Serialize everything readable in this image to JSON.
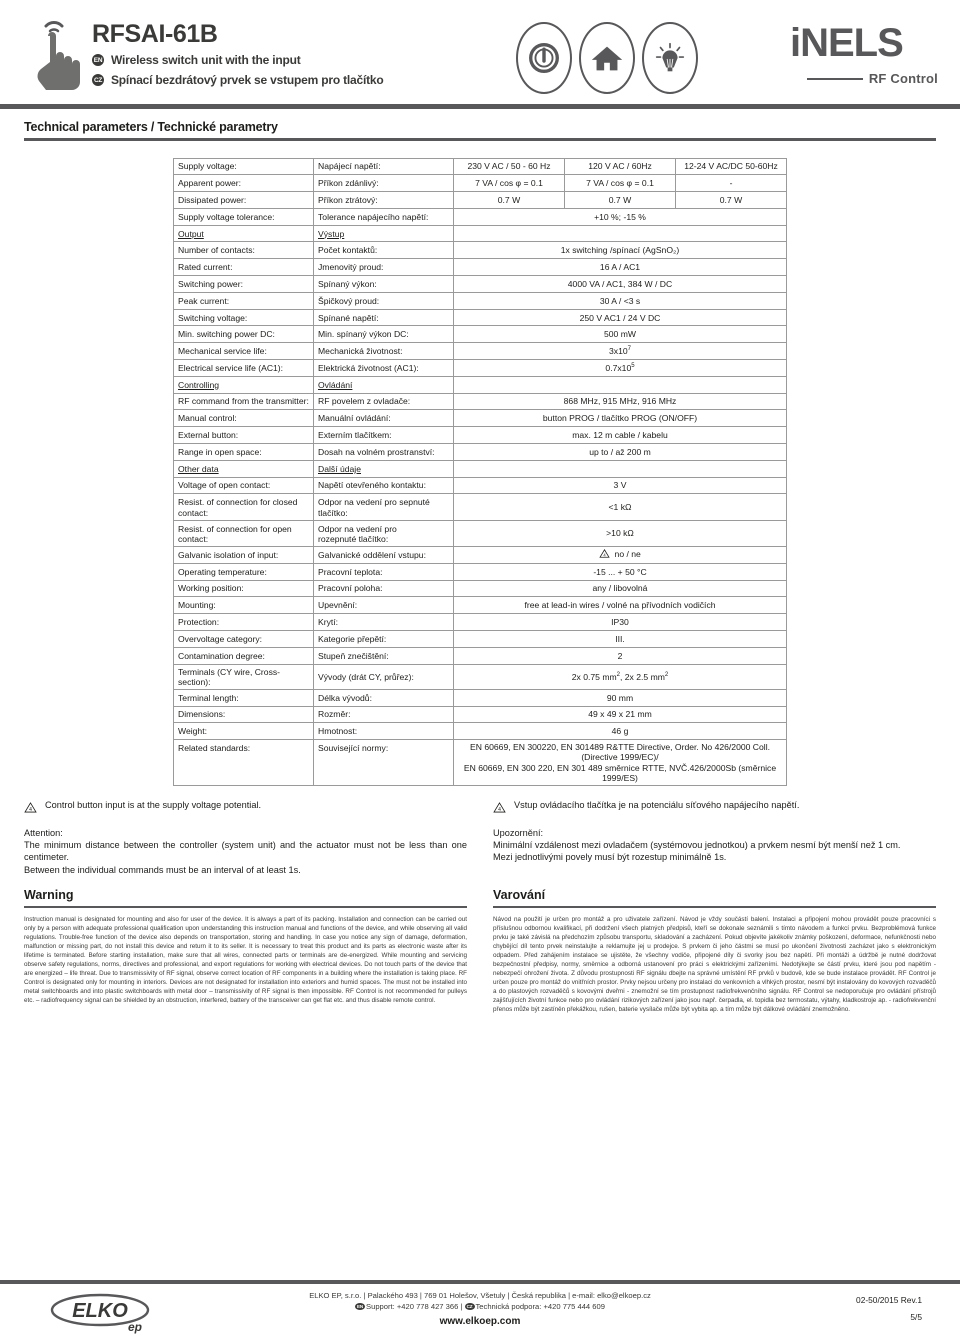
{
  "header": {
    "product_code": "RFSAI-61B",
    "en_badge": "EN",
    "cz_badge": "CZ",
    "en_subtitle": "Wireless switch unit with the input",
    "cz_subtitle": "Spínací bezdrátový prvek se vstupem pro tlačítko",
    "icons": [
      "power-icon",
      "home-icon",
      "bulb-icon"
    ],
    "brand": "iNELS",
    "brand_tagline": "RF Control"
  },
  "tech_section": {
    "title": "Technical parameters / Technické parametry"
  },
  "table": {
    "rows": [
      {
        "type": "multi",
        "en": "Supply voltage:",
        "cz": "Napájecí napětí:",
        "v1": "230 V AC / 50 - 60 Hz",
        "v2": "120 V AC / 60Hz",
        "v3": "12-24 V AC/DC 50-60Hz"
      },
      {
        "type": "multi",
        "en": "Apparent power:",
        "cz": "Příkon zdánlivý:",
        "v1": "7 VA / cos φ = 0.1",
        "v2": "7 VA / cos φ = 0.1",
        "v3": "-"
      },
      {
        "type": "multi",
        "en": "Dissipated power:",
        "cz": "Příkon ztrátový:",
        "v1": "0.7 W",
        "v2": "0.7 W",
        "v3": "0.7 W"
      },
      {
        "type": "single",
        "en": "Supply voltage tolerance:",
        "cz": "Tolerance napájecího napětí:",
        "v": "+10 %; -15 %"
      },
      {
        "type": "group",
        "en": "Output",
        "cz": "Výstup"
      },
      {
        "type": "single",
        "en": "Number of contacts:",
        "cz": "Počet kontaktů:",
        "v": "1x switching /spínací (AgSnO₂)"
      },
      {
        "type": "single",
        "en": "Rated current:",
        "cz": "Jmenovitý proud:",
        "v": "16 A / AC1"
      },
      {
        "type": "single",
        "en": "Switching power:",
        "cz": "Spínaný výkon:",
        "v": "4000 VA / AC1, 384 W / DC"
      },
      {
        "type": "single",
        "en": "Peak current:",
        "cz": "Špičkový proud:",
        "v": "30 A / <3 s"
      },
      {
        "type": "single",
        "en": "Switching voltage:",
        "cz": "Spínané napětí:",
        "v": "250 V AC1 / 24 V DC"
      },
      {
        "type": "single",
        "en": "Min. switching power DC:",
        "cz": "Min. spínaný výkon DC:",
        "v": "500 mW"
      },
      {
        "type": "sup",
        "en": "Mechanical service life:",
        "cz": "Mechanická životnost:",
        "base": "3x10",
        "exp": "7"
      },
      {
        "type": "sup",
        "en": "Electrical service life (AC1):",
        "cz": "Elektrická životnost (AC1):",
        "base": "0.7x10",
        "exp": "5"
      },
      {
        "type": "group",
        "en": "Controlling",
        "cz": "Ovládání"
      },
      {
        "type": "single",
        "en": "RF command from the transmitter:",
        "cz": "RF povelem z ovladače:",
        "v": "868 MHz, 915 MHz, 916 MHz"
      },
      {
        "type": "single",
        "en": "Manual control:",
        "cz": "Manuální ovládání:",
        "v": "button PROG / tlačítko PROG (ON/OFF)"
      },
      {
        "type": "single",
        "en": "External button:",
        "cz": "Externím tlačítkem:",
        "v": "max. 12 m cable / kabelu"
      },
      {
        "type": "single",
        "en": "Range in open space:",
        "cz": "Dosah na volném prostranství:",
        "v": "up to / až 200 m"
      },
      {
        "type": "group",
        "en": "Other data",
        "cz": "Další údaje"
      },
      {
        "type": "single",
        "en": "Voltage of open contact:",
        "cz": "Napětí otevřeného kontaktu:",
        "v": "3 V"
      },
      {
        "type": "two-line",
        "en1": "Resist. of connection for closed",
        "en2": "contact:",
        "cz1": "Odpor na vedení pro sepnuté",
        "cz2": "tlačítko:",
        "v": "<1 kΩ"
      },
      {
        "type": "two-line",
        "en1": "Resist. of connection for open",
        "en2": "contact:",
        "cz1": "Odpor na vedení pro",
        "cz2": "rozepnuté tlačítko:",
        "v": ">10 kΩ"
      },
      {
        "type": "warnval",
        "en": "Galvanic isolation of input:",
        "cz": "Galvanické oddělení vstupu:",
        "v": "no / ne"
      },
      {
        "type": "single",
        "en": "Operating temperature:",
        "cz": "Pracovní teplota:",
        "v": "-15 ... + 50 °C"
      },
      {
        "type": "single",
        "en": "Working position:",
        "cz": "Pracovní poloha:",
        "v": "any / libovolná"
      },
      {
        "type": "single",
        "en": "Mounting:",
        "cz": "Upevnění:",
        "v": "free at lead-in wires / volné na přívodních vodičích"
      },
      {
        "type": "single",
        "en": "Protection:",
        "cz": "Krytí:",
        "v": "IP30"
      },
      {
        "type": "single",
        "en": "Overvoltage category:",
        "cz": "Kategorie přepětí:",
        "v": "III."
      },
      {
        "type": "single",
        "en": "Contamination degree:",
        "cz": "Stupeň znečištění:",
        "v": "2"
      },
      {
        "type": "terminals",
        "en": "Terminals (CY wire, Cross-section):",
        "cz": "Vývody (drát CY, průřez):",
        "v_a": "2x 0.75 mm",
        "v_b": ",  2x 2.5 mm",
        "exp": "2"
      },
      {
        "type": "single",
        "en": "Terminal length:",
        "cz": "Délka vývodů:",
        "v": "90 mm"
      },
      {
        "type": "single",
        "en": "Dimensions:",
        "cz": "Rozměr:",
        "v": "49 x 49 x 21 mm"
      },
      {
        "type": "single",
        "en": "Weight:",
        "cz": "Hmotnost:",
        "v": "46 g"
      },
      {
        "type": "standards",
        "en": "Related standards:",
        "cz": "Související normy:",
        "line1": "EN 60669, EN 300220, EN 301489 R&TTE Directive, Order. No 426/2000 Coll. (Directive 1999/EC)/",
        "line2": "EN 60669, EN 300 220, EN 301 489 směrnice RTTE, NVČ.426/2000Sb (směrnice 1999/ES)"
      }
    ]
  },
  "notes": {
    "en": {
      "warning_line": "Control button input is at the supply voltage potential.",
      "attention_label": "Attention:",
      "attention_body": "The minimum distance between the controller (system unit) and the actuator must not be less than one centimeter.",
      "attention_body2": "Between the individual commands must be an interval of at least 1s."
    },
    "cz": {
      "warning_line": "Vstup ovládacího tlačítka je na potenciálu síťového napájecího napětí.",
      "attention_label": "Upozornění:",
      "attention_body": "Minimální vzdálenost mezi ovladačem (systémovou jednotkou) a prvkem nesmí být menší než 1 cm.",
      "attention_body2": "Mezi jednotlivými povely musí být rozestup minimálně 1s."
    }
  },
  "warning_section": {
    "en_title": "Warning",
    "cz_title": "Varování",
    "en_body": "Instruction manual is designated for mounting and also for user of the device. It is always a part of its packing. Installation and connection can be carried out only by a person with adequate professional qualification upon understanding this instruction manual and functions of the device, and while observing all valid regulations. Trouble-free function of the device also depends on transportation, storing and handling. In case you notice any sign of damage, deformation, malfunction or missing part, do not install this device and return it to its seller. It is necessary to treat this product and its parts as electronic waste after its lifetime is terminated. Before starting installation, make sure that all wires, connected parts or terminals are de-energized. While mounting and servicing observe safety regulations, norms, directives and professional, and export regulations for working with electrical devices. Do not touch parts of the device that are energized – life threat. Due to transmissivity of RF signal, observe correct location of RF components in a building where the installation is taking place. RF Control is designated only for mounting in interiors. Devices are not designated for installation into exteriors and humid spaces. The must not be installed into metal switchboards and into plastic switchboards with metal door – transmissivity of RF signal is then impossible.  RF Control is not recommended for pulleys etc. – radiofrequency signal can be shielded by an obstruction, interfered, battery of the transceiver can get flat etc. and thus disable remote control.",
    "cz_body": "Návod na použití je určen pro montáž a pro uživatele zařízení. Návod je vždy součástí balení. Instalaci a připojení mohou provádět pouze pracovníci s příslušnou odbornou kvalifikací, při dodržení všech platných předpisů, kteří se dokonale seznámili s tímto návodem a funkcí prvku. Bezproblémová funkce prvku je také závislá na předchozím způsobu transportu, skladování a zacházení. Pokud objevíte jakékoliv známky poškození, deformace, nefunkčnosti nebo chybějící díl tento prvek neinstalujte a reklamujte jej u prodejce. S prvkem či jeho částmi se musí po ukončení životnosti zacházet jako s elektronickým odpadem. Před zahájením instalace se ujistěte, že všechny vodiče, připojené díly či svorky jsou bez napětí. Při montáži a údržbě je  nutné dodržovat bezpečnostní předpisy, normy, směrnice a odborná ustanovení pro práci s elektrickými zařízeními. Nedotýkejte se částí prvku, které jsou pod napětím - nebezpečí ohrožení života. Z důvodu prostupnosti RF signálu dbejte na správné umístění RF prvků v budově, kde se bude instalace provádět. RF Control je určen pouze pro montáž do vnitřních prostor. Prvky nejsou určeny pro instalaci do venkovních a vlhkých prostor, nesmí být instalovány do kovových rozvaděčů a do plastových rozvaděčů s kovovými dveřmi - znemožní se tím prostupnost radiofrekvenčního signálu. RF Control se nedoporučuje pro ovládání přístrojů zajišťujících životní funkce nebo pro ovládání rizikových zařízení jako jsou např. čerpadla, el. topidla bez termostatu, výtahy, kladkostroje ap. - radiofrekvenční přenos může být zastíněn překážkou, rušen, baterie vysílače může být vybita ap. a tím může být dálkové ovládání znemožněno."
  },
  "footer": {
    "logo_main": "ELKO",
    "logo_sub": "ep",
    "address": "ELKO EP, s.r.o. | Palackého 493 | 769 01 Holešov, Všetuly | Česká republika | e-mail: elko@elkoep.cz",
    "support_en_badge": "EN",
    "support_en": "Support: +420 778 427 366 |",
    "support_cz_badge": "CZ",
    "support_cz": "Technická podpora: +420 775 444 609",
    "website": "www.elkoep.com",
    "revision": "02-50/2015 Rev.1",
    "page": "5/5"
  },
  "colors": {
    "dark": "#58585a",
    "text": "#1d1d1b",
    "rule": "#9a9a9a"
  }
}
